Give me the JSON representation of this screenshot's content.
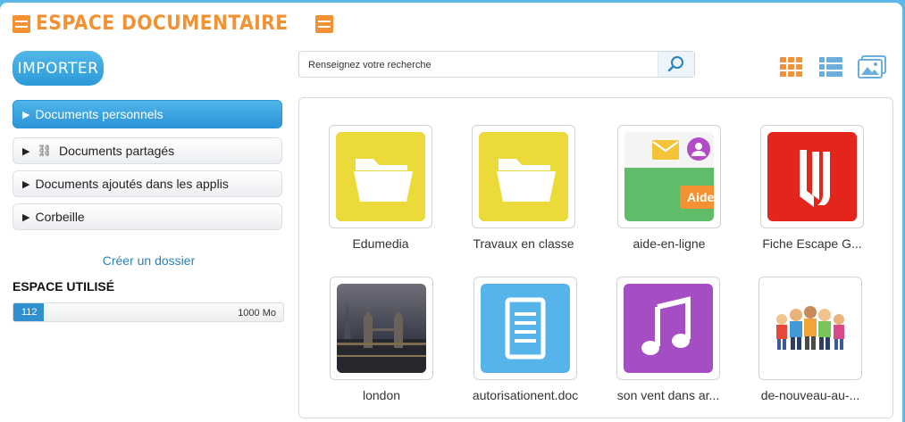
{
  "header": {
    "title": "ESPACE DOCUMENTAIRE"
  },
  "toolbar": {
    "import_label": "IMPORTER"
  },
  "search": {
    "placeholder": "Renseignez votre recherche",
    "value": ""
  },
  "nav": {
    "items": [
      {
        "label": "Documents personnels",
        "active": true
      },
      {
        "label": "Documents partagés",
        "active": false
      },
      {
        "label": "Documents ajoutés dans les applis",
        "active": false
      },
      {
        "label": "Corbeille",
        "active": false
      }
    ],
    "create_folder": "Créer un dossier"
  },
  "storage": {
    "label": "ESPACE UTILISÉ",
    "used": "112",
    "max": "1000 Mo",
    "used_fraction": 0.112
  },
  "files": [
    {
      "label": "Edumedia",
      "kind": "folder"
    },
    {
      "label": "Travaux en classe",
      "kind": "folder"
    },
    {
      "label": "aide-en-ligne",
      "kind": "image",
      "badge": "Aide"
    },
    {
      "label": "Fiche Escape G...",
      "kind": "app"
    },
    {
      "label": "london",
      "kind": "photo"
    },
    {
      "label": "autorisationent.doc",
      "kind": "document"
    },
    {
      "label": "son vent dans ar...",
      "kind": "audio"
    },
    {
      "label": "de-nouveau-au-...",
      "kind": "image"
    }
  ],
  "colors": {
    "accent": "#f39133",
    "primary": "#2a94d6",
    "folder": "#ecd93a",
    "audio": "#a54ec3",
    "doc": "#55b4ea",
    "app": "#e4251b"
  },
  "icons": {
    "view_grid": "grid-icon",
    "view_list": "list-icon",
    "view_gallery": "gallery-icon",
    "search": "search-icon"
  }
}
